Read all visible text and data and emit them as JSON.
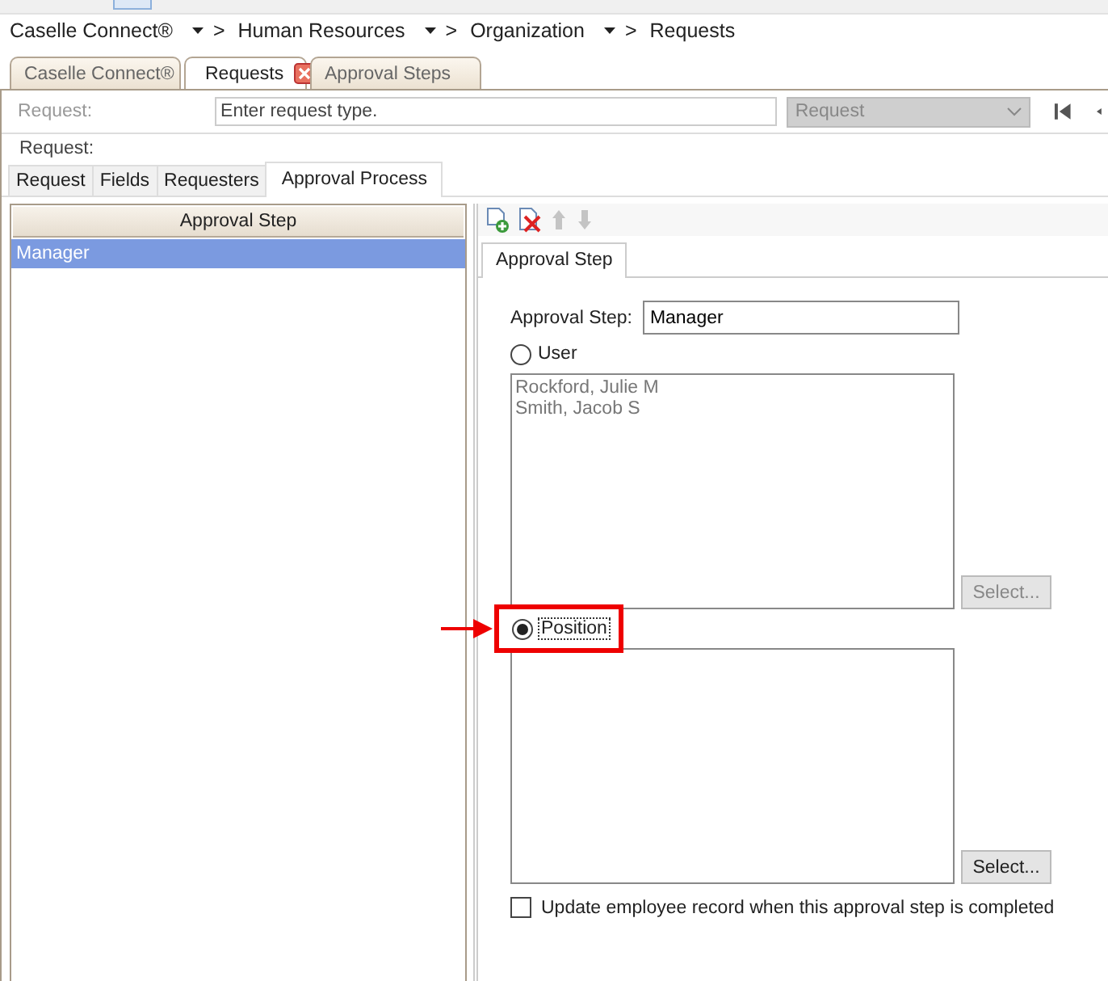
{
  "breadcrumb": [
    {
      "label": "Caselle Connect®",
      "separator": ">"
    },
    {
      "label": "Human Resources",
      "separator": ">"
    },
    {
      "label": "Organization",
      "separator": ">"
    },
    {
      "label": "Requests"
    }
  ],
  "document_tabs": [
    {
      "label": "Caselle Connect®",
      "selected": false,
      "closable": false
    },
    {
      "label": "Requests",
      "selected": true,
      "closable": true
    },
    {
      "label": "Approval Steps",
      "selected": false,
      "closable": false
    }
  ],
  "request_bar": {
    "label": "Request:",
    "placeholder": "Enter request type.",
    "type_select": "Request"
  },
  "request_caption": "Request:",
  "section_tabs": [
    {
      "label": "Request",
      "selected": false
    },
    {
      "label": "Fields",
      "selected": false
    },
    {
      "label": "Requesters",
      "selected": false
    },
    {
      "label": "Approval Process",
      "selected": true
    }
  ],
  "steps_grid": {
    "header": "Approval Step",
    "rows": [
      {
        "name": "Manager",
        "selected": true
      }
    ]
  },
  "toolbar": [
    {
      "kind": "add",
      "disabled": false
    },
    {
      "kind": "delete",
      "disabled": false
    },
    {
      "kind": "up",
      "disabled": true
    },
    {
      "kind": "down",
      "disabled": true
    }
  ],
  "detail_tab": {
    "label": "Approval Step",
    "selected": true
  },
  "approval_step_field": {
    "label": "Approval Step:",
    "value": "Manager"
  },
  "approver_options": [
    {
      "label": "User",
      "selected": false,
      "highlighted": false,
      "entries": [
        "Rockford, Julie M",
        "Smith, Jacob S"
      ],
      "button": "Select..."
    },
    {
      "label": "Position",
      "selected": true,
      "highlighted": true,
      "button": "Select..."
    }
  ],
  "update_record": {
    "label": "Update employee record when this approval step is completed",
    "checked": false
  }
}
